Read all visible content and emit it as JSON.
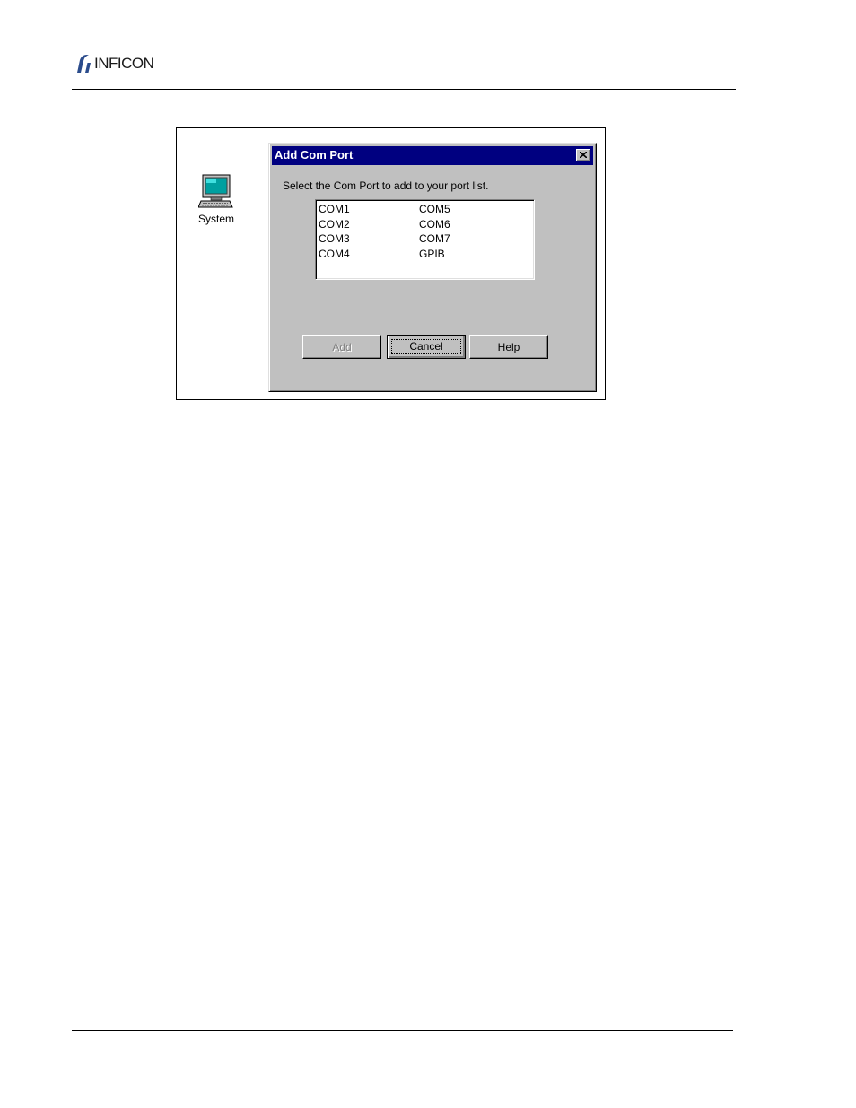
{
  "header": {
    "logo_text": "INFICON",
    "brand_color": "#2b4c8c"
  },
  "desktop": {
    "icon": "computer-icon",
    "label": "System"
  },
  "dialog": {
    "title": "Add Com Port",
    "close_icon": "close-icon",
    "prompt": "Select the Com Port to add to your port list.",
    "ports_col1": [
      "COM1",
      "COM2",
      "COM3",
      "COM4"
    ],
    "ports_col2": [
      "COM5",
      "COM6",
      "COM7",
      "GPIB"
    ],
    "buttons": {
      "add": "Add",
      "cancel": "Cancel",
      "help": "Help"
    },
    "title_color": "#000080",
    "face_color": "#c0c0c0"
  }
}
